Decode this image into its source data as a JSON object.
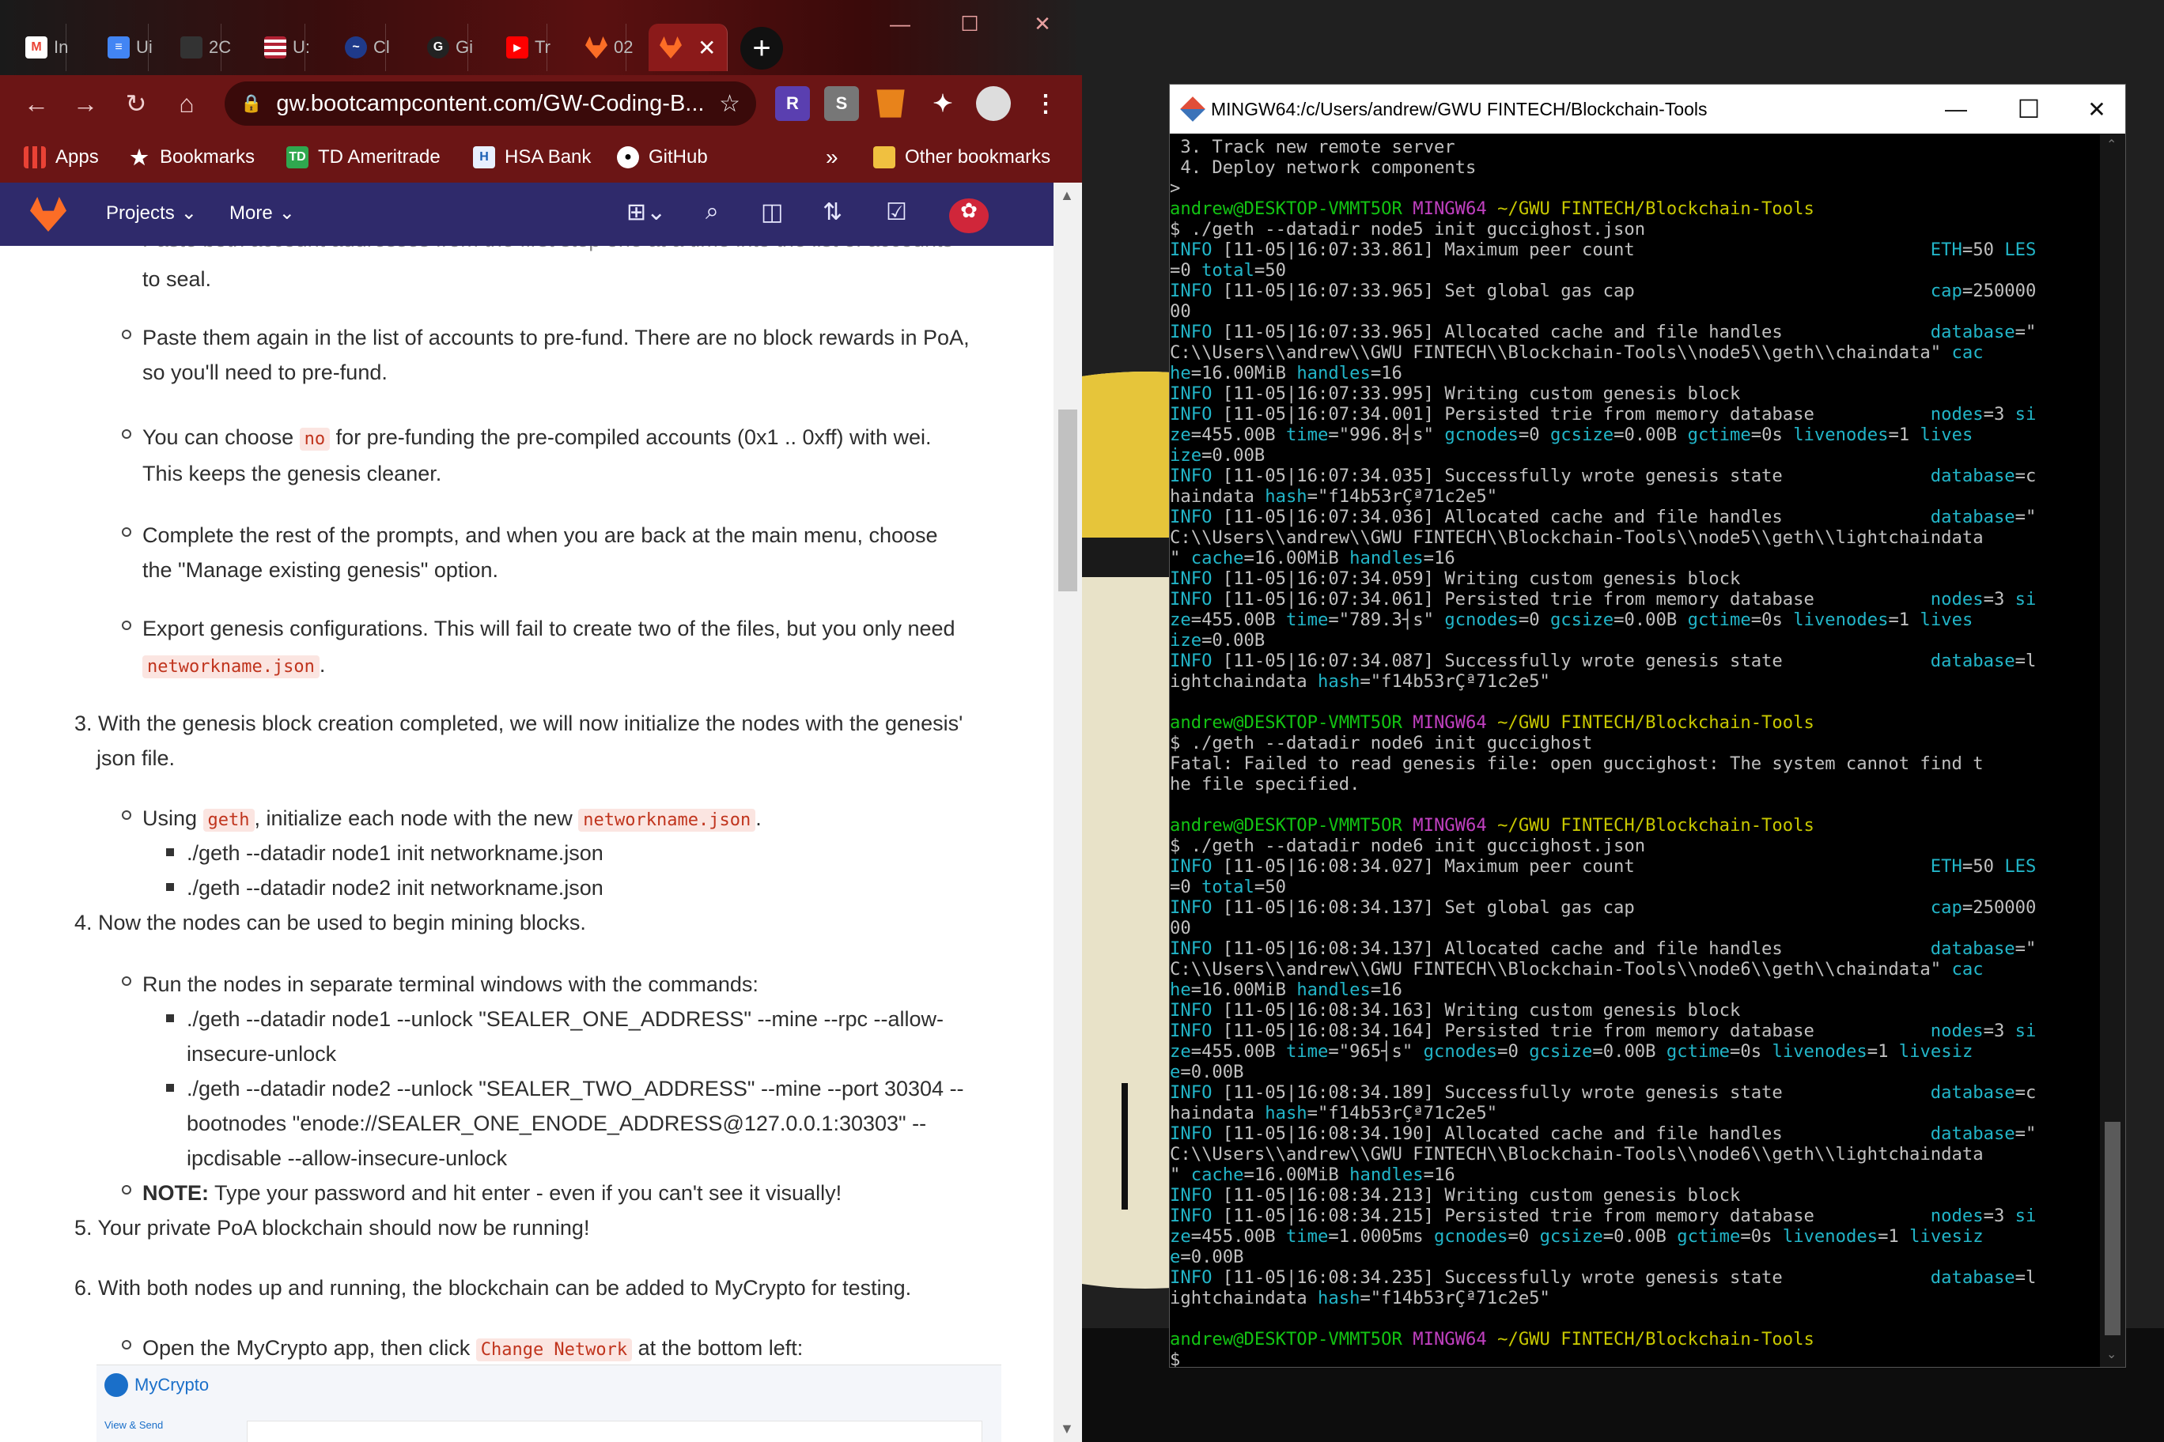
{
  "browser": {
    "tabs": [
      {
        "icon": "gmail-icon",
        "label": "In",
        "color": "#ea4335"
      },
      {
        "icon": "docs-icon",
        "label": "Ui",
        "color": "#4285f4"
      },
      {
        "icon": "blank-icon",
        "label": "2C",
        "color": "#333333"
      },
      {
        "icon": "flag-icon",
        "label": "U:",
        "color": "#b22234"
      },
      {
        "icon": "cl-icon",
        "label": "Cl",
        "color": "#1f3a8a"
      },
      {
        "icon": "github-icon",
        "label": "Gi",
        "color": "#222222"
      },
      {
        "icon": "youtube-icon",
        "label": "Tr",
        "color": "#ff0000"
      },
      {
        "icon": "gitlab-icon",
        "label": "02",
        "color": "#fc6d26"
      },
      {
        "icon": "gitlab-icon",
        "label": "",
        "color": "#fc6d26",
        "active": true
      }
    ],
    "window_controls": {
      "minimize": "—",
      "maximize": "☐",
      "close": "✕"
    },
    "url": "gw.bootcampcontent.com/GW-Coding-B...",
    "extensions": [
      "R",
      "S",
      "metamask",
      "puzzle",
      "avatar"
    ],
    "bookmarks": [
      {
        "label": "Apps",
        "icon": "apps-grid-icon"
      },
      {
        "label": "Bookmarks",
        "icon": "star-icon"
      },
      {
        "label": "TD Ameritrade",
        "icon": "td-icon"
      },
      {
        "label": "HSA Bank",
        "icon": "hsa-icon"
      },
      {
        "label": "GitHub",
        "icon": "github-icon"
      }
    ],
    "bookmarks_overflow": "»",
    "other_bookmarks": "Other bookmarks"
  },
  "gitlab": {
    "projects": "Projects",
    "more": "More"
  },
  "article": {
    "l0": "Paste both account addresses from the first step one at a time into the list of accounts",
    "l1": "to seal.",
    "l2": "Paste them again in the list of accounts to pre-fund. There are no block rewards in PoA,",
    "l3": "so you'll need to pre-fund.",
    "l4a": "You can choose ",
    "l4code": "no",
    "l4b": " for pre-funding the pre-compiled accounts (0x1 .. 0xff) with wei.",
    "l5": "This keeps the genesis cleaner.",
    "l6": "Complete the rest of the prompts, and when you are back at the main menu, choose",
    "l7": "the \"Manage existing genesis\" option.",
    "l8": "Export genesis configurations. This will fail to create two of the files, but you only need",
    "l9code": "networkname.json",
    "l9b": ".",
    "l10": "3. With the genesis block creation completed, we will now initialize the nodes with the genesis'",
    "l11": "json file.",
    "l12a": "Using ",
    "l12code1": "geth",
    "l12b": ", initialize each node with the new ",
    "l12code2": "networkname.json",
    "l12c": ".",
    "l13": "./geth --datadir node1 init networkname.json",
    "l14": "./geth --datadir node2 init networkname.json",
    "l15": "4. Now the nodes can be used to begin mining blocks.",
    "l16": "Run the nodes in separate terminal windows with the commands:",
    "l17": "./geth --datadir node1 --unlock \"SEALER_ONE_ADDRESS\" --mine --rpc --allow-",
    "l18": "insecure-unlock",
    "l19": "./geth --datadir node2 --unlock \"SEALER_TWO_ADDRESS\" --mine --port 30304 --",
    "l20": "bootnodes \"enode://SEALER_ONE_ENODE_ADDRESS@127.0.0.1:30303\" --",
    "l21": "ipcdisable --allow-insecure-unlock",
    "l22b": "NOTE:",
    "l22": " Type your password and hit enter - even if you can't see it visually!",
    "l23": "5. Your private PoA blockchain should now be running!",
    "l24": "6. With both nodes up and running, the blockchain can be added to MyCrypto for testing.",
    "l25a": "Open the MyCrypto app, then click ",
    "l25code": "Change Network",
    "l25b": " at the bottom left:",
    "mycrypto_logo": "MyCrypto",
    "mycrypto_nav": "View & Send"
  },
  "terminal": {
    "title": "MINGW64:/c/Users/andrew/GWU FINTECH/Blockchain-Tools",
    "controls": {
      "minimize": "—",
      "maximize": "☐",
      "close": "✕"
    },
    "lines": [
      " 3. Track new remote server",
      " 4. Deploy network components",
      ">",
      "",
      "$ ./geth --datadir node5 init guccighost.json",
      "[11-05|16:07:33.861] Maximum peer count",
      "=0 ",
      "[11-05|16:07:33.965] Set global gas cap",
      "00",
      "[11-05|16:07:33.965] Allocated cache and file handles",
      "C:\\\\Users\\\\andrew\\\\GWU FINTECH\\\\Blockchain-Tools\\\\node5\\\\geth\\\\chaindata\" ",
      "",
      "[11-05|16:07:33.995] Writing custom genesis block",
      "[11-05|16:07:34.001] Persisted trie from memory database",
      "",
      "",
      "[11-05|16:07:34.035] Successfully wrote genesis state",
      "haindata ",
      "[11-05|16:07:34.036] Allocated cache and file handles",
      "C:\\\\Users\\\\andrew\\\\GWU FINTECH\\\\Blockchain-Tools\\\\node5\\\\geth\\\\lightchaindata",
      "[11-05|16:07:34.059] Writing custom genesis block",
      "[11-05|16:07:34.061] Persisted trie from memory database",
      "",
      "",
      "[11-05|16:07:34.087] Successfully wrote genesis state",
      "ightchaindata ",
      "",
      "",
      "$ ./geth --datadir node6 init guccighost",
      "Fatal: Failed to read genesis file: open guccighost: The system cannot find t",
      "he file specified.",
      "",
      "",
      "$ ./geth --datadir node6 init guccighost.json",
      "[11-05|16:08:34.027] Maximum peer count",
      "=0 ",
      "[11-05|16:08:34.137] Set global gas cap",
      "00",
      "[11-05|16:08:34.137] Allocated cache and file handles",
      "C:\\\\Users\\\\andrew\\\\GWU FINTECH\\\\Blockchain-Tools\\\\node6\\\\geth\\\\chaindata\" ",
      "",
      "[11-05|16:08:34.163] Writing custom genesis block",
      "[11-05|16:08:34.164] Persisted trie from memory database",
      "",
      "",
      "[11-05|16:08:34.189] Successfully wrote genesis state",
      "haindata ",
      "[11-05|16:08:34.190] Allocated cache and file handles",
      "C:\\\\Users\\\\andrew\\\\GWU FINTECH\\\\Blockchain-Tools\\\\node6\\\\geth\\\\lightchaindata",
      "[11-05|16:08:34.213] Writing custom genesis block",
      "[11-05|16:08:34.215] Persisted trie from memory database",
      "",
      "",
      "[11-05|16:08:34.235] Successfully wrote genesis state",
      "ightchaindata ",
      "",
      "",
      "$ "
    ],
    "prompt_user": "andrew@DESKTOP-VMMT5OR",
    "prompt_sys": "MINGW64",
    "prompt_path": "~/GWU FINTECH/Blockchain-Tools",
    "info": "INFO",
    "kv": {
      "eth": "ETH",
      "eth_val": "=50 ",
      "les": "LES",
      "total": "total",
      "total_val": "=50",
      "cap": "cap",
      "cap_val": "=250000",
      "database": "database",
      "db_val_q": "=\"",
      "db_val_c": "=c",
      "db_val_l": "=l",
      "cac": "cac",
      "he": "he",
      "he_val": "=16.00MiB ",
      "handles": "handles",
      "handles_val": "=16",
      "cache": "cache",
      "cache_val": "=16.00MiB ",
      "quote_sp": "\" ",
      "nodes": "nodes",
      "nodes_val": "=3 ",
      "si": "si",
      "ze": "ze",
      "ze_val": "=455.00B ",
      "time": "time",
      "time1": "=\"996.8┤s\" ",
      "time2": "=\"789.3┤s\" ",
      "time3": "=\"965┤s\" ",
      "time4": "=1.0005ms ",
      "gcnodes": "gcnodes",
      "gcnodes_val": "=0 ",
      "gcsize": "gcsize",
      "gcsize_val": "=0.00B ",
      "gctime": "gctime",
      "gctime_val": "=0s ",
      "livenodes": "livenodes",
      "livenodes_val": "=1 ",
      "lives": "lives",
      "livesiz": "livesiz",
      "ize": "ize",
      "ize_val": "=0.00B",
      "e": "e",
      "e_val": "=0.00B",
      "hash": "hash",
      "hash_val": "=\"f14b53rÇª71c2e5\""
    }
  }
}
